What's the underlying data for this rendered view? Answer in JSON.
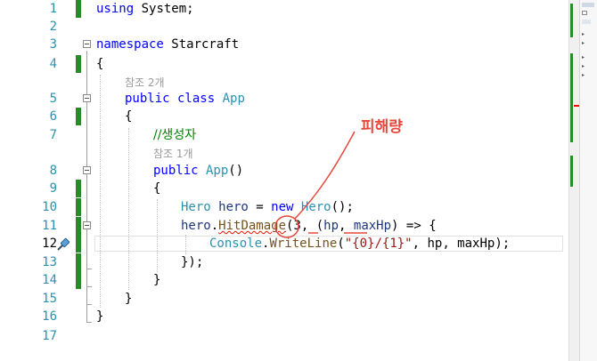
{
  "editor": {
    "lines": [
      {
        "n": "1"
      },
      {
        "n": "2"
      },
      {
        "n": "3"
      },
      {
        "n": "4"
      },
      {
        "n": "5"
      },
      {
        "n": "6"
      },
      {
        "n": "7"
      },
      {
        "n": "8"
      },
      {
        "n": "9"
      },
      {
        "n": "10"
      },
      {
        "n": "11"
      },
      {
        "n": "12"
      },
      {
        "n": "13"
      },
      {
        "n": "14"
      },
      {
        "n": "15"
      },
      {
        "n": "16"
      },
      {
        "n": "17"
      }
    ],
    "references": {
      "app_class": "참조 2개",
      "app_ctor": "참조 1개"
    },
    "tokens": {
      "using": "using",
      "system": " System;",
      "namespace": "namespace",
      "ns_name": " Starcraft",
      "open_brace": "{",
      "close_brace": "}",
      "public": "public",
      "class": " class ",
      "app": "App",
      "comment": "//생성자",
      "ctor_name": " App",
      "ctor_parens": "()",
      "hero_type": "Hero",
      "hero_var": " hero",
      "assign": " = ",
      "new": "new",
      "hero_ctor": " Hero",
      "ctor_end": "();",
      "hero_obj": "hero",
      "dot": ".",
      "hitdamage": "HitDamage",
      "arg3_open": "(3, (",
      "hp": "hp",
      "comma": ", ",
      "maxhp": "maxHp",
      "lambda": ") => {",
      "console": "Console",
      "writeline": "WriteLine",
      "paren_open": "(",
      "format_str": "\"{0}/{1}\"",
      "args": ", hp, maxHp);",
      "close_call": "});"
    }
  },
  "annotation": {
    "label": "피해량",
    "color": "#e8473b"
  },
  "colors": {
    "keyword": "#0000ff",
    "type": "#2b91af",
    "comment": "#008000",
    "string": "#a31515",
    "change_bar": "#2a8a2a"
  }
}
